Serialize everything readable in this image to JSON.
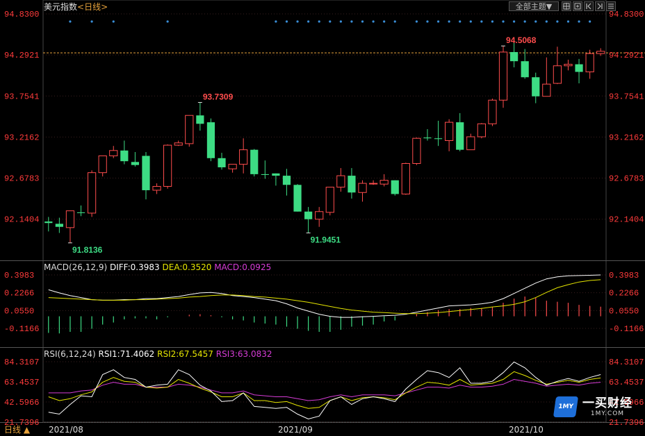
{
  "header": {
    "title": "美元指数",
    "period_open": "<",
    "period": "日线",
    "period_close": ">",
    "theme_button": "全部主题",
    "theme_arrow": "▼",
    "tool_icons": [
      "crosshair-icon",
      "zoom-fit-icon",
      "first-page-icon",
      "last-page-icon",
      "options-icon"
    ]
  },
  "footer": {
    "period_label": "日线",
    "period_arrow": "▲",
    "x_labels": [
      "2021/08",
      "2021/09",
      "2021/10"
    ]
  },
  "brand": {
    "name": "一买财经",
    "url": "1MY.COM",
    "badge": "1MY"
  },
  "colors": {
    "up": "#ff4d4d",
    "down": "#3ddc84",
    "axis_text": "#ff3b3b",
    "diff": "#ffffff",
    "dea": "#e6e600",
    "macd": "#d63cd6",
    "rsi1": "#ffffff",
    "rsi2": "#e6e600",
    "rsi3": "#d63cd6",
    "dots": "#3a8fd9"
  },
  "chart_data": [
    {
      "type": "candlestick",
      "title": "美元指数 日线",
      "y_ticks": [
        "94.8300",
        "94.2921",
        "93.7541",
        "93.2162",
        "92.6783",
        "92.1404"
      ],
      "ylim": [
        91.76,
        94.83
      ],
      "last_price_line": 94.32,
      "annotations": [
        {
          "label": "94.5068",
          "index": 42,
          "kind": "high"
        },
        {
          "label": "93.7309",
          "index": 14,
          "kind": "high"
        },
        {
          "label": "91.8136",
          "index": 2,
          "kind": "low"
        },
        {
          "label": "91.9451",
          "index": 24,
          "kind": "low"
        }
      ],
      "x_labels": [
        "2021/08",
        "2021/09",
        "2021/10"
      ],
      "signal_dot_indices": [
        2,
        4,
        6,
        11,
        21,
        22,
        23,
        24,
        25,
        26,
        27,
        28,
        29,
        30,
        31,
        32,
        34,
        35,
        36,
        37,
        38,
        39,
        40,
        41,
        42,
        43,
        44,
        45,
        46,
        47,
        48,
        49,
        50
      ],
      "ohlc": [
        [
          92.11,
          92.17,
          91.98,
          92.09
        ],
        [
          92.08,
          92.16,
          91.96,
          92.04
        ],
        [
          92.03,
          92.24,
          91.83,
          92.25
        ],
        [
          92.23,
          92.32,
          92.18,
          92.22
        ],
        [
          92.22,
          92.78,
          92.17,
          92.75
        ],
        [
          92.75,
          92.96,
          92.7,
          92.97
        ],
        [
          92.97,
          93.1,
          92.94,
          93.04
        ],
        [
          93.04,
          93.17,
          92.86,
          92.9
        ],
        [
          92.89,
          93.02,
          92.83,
          92.85
        ],
        [
          92.97,
          93.02,
          92.4,
          92.52
        ],
        [
          92.52,
          92.61,
          92.47,
          92.57
        ],
        [
          92.57,
          93.12,
          92.54,
          93.11
        ],
        [
          93.11,
          93.17,
          93.1,
          93.14
        ],
        [
          93.13,
          93.46,
          93.09,
          93.5
        ],
        [
          93.5,
          93.67,
          93.3,
          93.39
        ],
        [
          93.41,
          93.46,
          92.9,
          92.94
        ],
        [
          92.94,
          93.01,
          92.79,
          92.82
        ],
        [
          92.8,
          92.86,
          92.75,
          92.86
        ],
        [
          92.86,
          93.2,
          92.74,
          93.05
        ],
        [
          93.05,
          93.06,
          92.7,
          92.73
        ],
        [
          92.73,
          92.91,
          92.67,
          92.72
        ],
        [
          92.74,
          92.74,
          92.58,
          92.71
        ],
        [
          92.71,
          92.8,
          92.45,
          92.59
        ],
        [
          92.59,
          92.6,
          92.24,
          92.24
        ],
        [
          92.24,
          92.3,
          91.96,
          92.14
        ],
        [
          92.14,
          92.3,
          92.04,
          92.24
        ],
        [
          92.23,
          92.56,
          92.19,
          92.56
        ],
        [
          92.56,
          92.81,
          92.5,
          92.71
        ],
        [
          92.71,
          92.81,
          92.41,
          92.49
        ],
        [
          92.49,
          92.65,
          92.37,
          92.61
        ],
        [
          92.61,
          92.65,
          92.59,
          92.61
        ],
        [
          92.6,
          92.73,
          92.57,
          92.65
        ],
        [
          92.65,
          92.65,
          92.45,
          92.47
        ],
        [
          92.47,
          92.88,
          92.46,
          92.87
        ],
        [
          92.87,
          93.21,
          92.85,
          93.2
        ],
        [
          93.21,
          93.32,
          93.17,
          93.2
        ],
        [
          93.2,
          93.43,
          93.1,
          93.19
        ],
        [
          93.17,
          93.45,
          93.03,
          93.41
        ],
        [
          93.41,
          93.53,
          93.03,
          93.05
        ],
        [
          93.05,
          93.26,
          93.06,
          93.22
        ],
        [
          93.22,
          93.4,
          93.2,
          93.39
        ],
        [
          93.39,
          93.72,
          93.36,
          93.7
        ],
        [
          93.7,
          94.41,
          93.6,
          94.33
        ],
        [
          94.33,
          94.47,
          94.13,
          94.21
        ],
        [
          94.21,
          94.37,
          93.98,
          94.0
        ],
        [
          94.0,
          94.06,
          93.66,
          93.75
        ],
        [
          93.75,
          94.26,
          93.77,
          93.91
        ],
        [
          93.92,
          94.4,
          93.91,
          94.15
        ],
        [
          94.15,
          94.23,
          94.09,
          94.17
        ],
        [
          94.17,
          94.24,
          93.92,
          94.07
        ],
        [
          94.07,
          94.36,
          93.98,
          94.31
        ],
        [
          94.31,
          94.38,
          94.28,
          94.34
        ]
      ]
    },
    {
      "type": "line",
      "title": "MACD(26,12,9)",
      "legend": [
        {
          "label": "DIFF:",
          "value": "0.3983"
        },
        {
          "label": "DEA:",
          "value": "0.3520"
        },
        {
          "label": "MACD:",
          "value": "0.0925"
        }
      ],
      "y_ticks": [
        "0.3983",
        "0.2266",
        "0.0550",
        "-0.1166"
      ],
      "ylim": [
        -0.23,
        0.44
      ],
      "series": [
        {
          "name": "DIFF",
          "values": [
            0.255,
            0.225,
            0.2,
            0.18,
            0.16,
            0.155,
            0.155,
            0.16,
            0.16,
            0.17,
            0.17,
            0.18,
            0.19,
            0.21,
            0.225,
            0.23,
            0.22,
            0.2,
            0.19,
            0.18,
            0.165,
            0.15,
            0.12,
            0.08,
            0.05,
            0.02,
            0.0,
            -0.01,
            -0.01,
            -0.005,
            0.0,
            0.005,
            0.01,
            0.02,
            0.04,
            0.06,
            0.08,
            0.1,
            0.105,
            0.11,
            0.12,
            0.135,
            0.17,
            0.22,
            0.27,
            0.32,
            0.36,
            0.38,
            0.39,
            0.392,
            0.395,
            0.398
          ]
        },
        {
          "name": "DEA",
          "values": [
            0.18,
            0.175,
            0.17,
            0.165,
            0.16,
            0.155,
            0.155,
            0.155,
            0.16,
            0.16,
            0.165,
            0.17,
            0.175,
            0.185,
            0.19,
            0.2,
            0.205,
            0.205,
            0.2,
            0.19,
            0.185,
            0.175,
            0.165,
            0.15,
            0.135,
            0.115,
            0.095,
            0.075,
            0.06,
            0.05,
            0.04,
            0.035,
            0.03,
            0.025,
            0.025,
            0.03,
            0.035,
            0.045,
            0.055,
            0.065,
            0.075,
            0.09,
            0.1,
            0.115,
            0.14,
            0.18,
            0.23,
            0.275,
            0.305,
            0.33,
            0.345,
            0.352
          ]
        },
        {
          "name": "MACD",
          "values": [
            -0.16,
            -0.165,
            -0.15,
            -0.15,
            -0.12,
            -0.08,
            -0.06,
            -0.03,
            -0.02,
            -0.02,
            -0.03,
            -0.01,
            0.0,
            0.015,
            0.02,
            0.01,
            -0.01,
            -0.03,
            -0.04,
            -0.06,
            -0.07,
            -0.08,
            -0.1,
            -0.12,
            -0.14,
            -0.15,
            -0.15,
            -0.13,
            -0.1,
            -0.09,
            -0.08,
            -0.05,
            -0.04,
            0.0,
            0.02,
            0.04,
            0.06,
            0.07,
            0.07,
            0.08,
            0.08,
            0.09,
            0.13,
            0.17,
            0.19,
            0.18,
            0.15,
            0.14,
            0.13,
            0.11,
            0.1,
            0.0925
          ]
        }
      ]
    },
    {
      "type": "line",
      "title": "RSI(6,12,24)",
      "legend": [
        {
          "label": "RSI1:",
          "value": "71.4062"
        },
        {
          "label": "RSI2:",
          "value": "67.5457"
        },
        {
          "label": "RSI3:",
          "value": "63.0832"
        }
      ],
      "y_ticks": [
        "84.3107",
        "63.4537",
        "42.5966",
        "21.7396"
      ],
      "ylim": [
        17.5,
        88.0
      ],
      "series": [
        {
          "name": "RSI1",
          "values": [
            32,
            30,
            40,
            49,
            48,
            71,
            76,
            68,
            66,
            58,
            60,
            61,
            76,
            71,
            60,
            54,
            43,
            44,
            52,
            38,
            37,
            36,
            37,
            30,
            25,
            28,
            44,
            48,
            40,
            46,
            48,
            46,
            43,
            56,
            66,
            75,
            73,
            68,
            78,
            62,
            62,
            64,
            73,
            84,
            78,
            68,
            60,
            64,
            67,
            64,
            68,
            71
          ]
        },
        {
          "name": "RSI2",
          "values": [
            48,
            44,
            46,
            50,
            53,
            63,
            68,
            64,
            63,
            58,
            57,
            58,
            66,
            62,
            57,
            53,
            48,
            48,
            52,
            44,
            44,
            42,
            43,
            39,
            36,
            37,
            44,
            48,
            44,
            47,
            48,
            47,
            45,
            52,
            58,
            63,
            62,
            60,
            66,
            60,
            61,
            62,
            66,
            74,
            70,
            65,
            61,
            63,
            65,
            63,
            66,
            67.5
          ]
        },
        {
          "name": "RSI3",
          "values": [
            52,
            52,
            52,
            54,
            55,
            60,
            63,
            61,
            61,
            58,
            58,
            58,
            61,
            60,
            58,
            55,
            52,
            52,
            54,
            50,
            49,
            48,
            48,
            46,
            44,
            45,
            48,
            50,
            48,
            50,
            50,
            50,
            49,
            52,
            55,
            58,
            58,
            57,
            60,
            58,
            58,
            59,
            61,
            66,
            64,
            62,
            59,
            60,
            61,
            60,
            62,
            63
          ]
        }
      ]
    }
  ]
}
